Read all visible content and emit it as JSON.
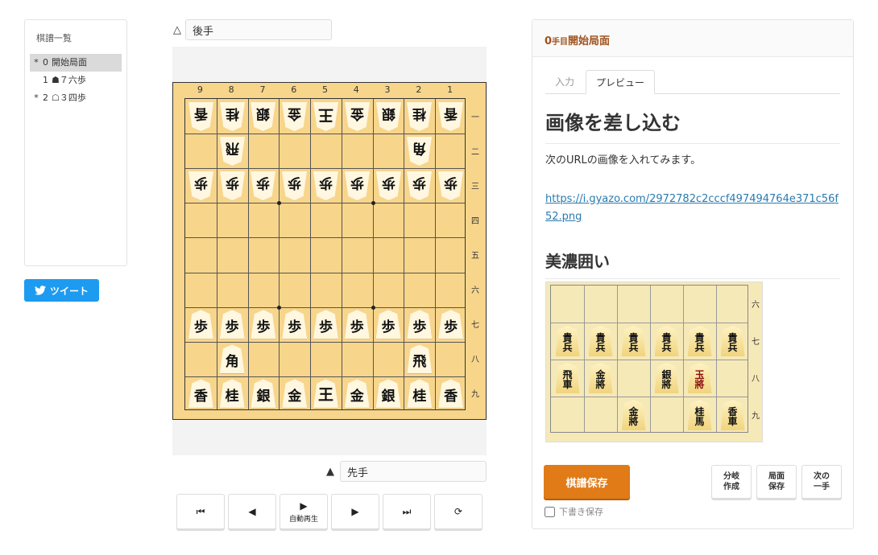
{
  "kifu_panel": {
    "title": "棋譜一覧",
    "moves": [
      {
        "mark": "*",
        "num": "0",
        "text": "開始局面",
        "selected": true
      },
      {
        "mark": "",
        "num": "1",
        "text": "☗７六歩",
        "selected": false
      },
      {
        "mark": "*",
        "num": "2",
        "text": "☖３四歩",
        "selected": false
      }
    ]
  },
  "tweet": {
    "label": "ツイート",
    "icon": "twitter-bird-icon"
  },
  "players": {
    "gote_mark": "△",
    "gote_name": "後手",
    "sente_mark": "▲",
    "sente_name": "先手"
  },
  "board": {
    "files": [
      "9",
      "8",
      "7",
      "6",
      "5",
      "4",
      "3",
      "2",
      "1"
    ],
    "ranks": [
      "一",
      "二",
      "三",
      "四",
      "五",
      "六",
      "七",
      "八",
      "九"
    ],
    "pieces": [
      {
        "f": 9,
        "r": 1,
        "p": "香",
        "side": "gote"
      },
      {
        "f": 8,
        "r": 1,
        "p": "桂",
        "side": "gote"
      },
      {
        "f": 7,
        "r": 1,
        "p": "銀",
        "side": "gote"
      },
      {
        "f": 6,
        "r": 1,
        "p": "金",
        "side": "gote"
      },
      {
        "f": 5,
        "r": 1,
        "p": "王",
        "side": "gote"
      },
      {
        "f": 4,
        "r": 1,
        "p": "金",
        "side": "gote"
      },
      {
        "f": 3,
        "r": 1,
        "p": "銀",
        "side": "gote"
      },
      {
        "f": 2,
        "r": 1,
        "p": "桂",
        "side": "gote"
      },
      {
        "f": 1,
        "r": 1,
        "p": "香",
        "side": "gote"
      },
      {
        "f": 8,
        "r": 2,
        "p": "飛",
        "side": "gote"
      },
      {
        "f": 2,
        "r": 2,
        "p": "角",
        "side": "gote"
      },
      {
        "f": 9,
        "r": 3,
        "p": "歩",
        "side": "gote"
      },
      {
        "f": 8,
        "r": 3,
        "p": "歩",
        "side": "gote"
      },
      {
        "f": 7,
        "r": 3,
        "p": "歩",
        "side": "gote"
      },
      {
        "f": 6,
        "r": 3,
        "p": "歩",
        "side": "gote"
      },
      {
        "f": 5,
        "r": 3,
        "p": "歩",
        "side": "gote"
      },
      {
        "f": 4,
        "r": 3,
        "p": "歩",
        "side": "gote"
      },
      {
        "f": 3,
        "r": 3,
        "p": "歩",
        "side": "gote"
      },
      {
        "f": 2,
        "r": 3,
        "p": "歩",
        "side": "gote"
      },
      {
        "f": 1,
        "r": 3,
        "p": "歩",
        "side": "gote"
      },
      {
        "f": 9,
        "r": 7,
        "p": "歩",
        "side": "sente"
      },
      {
        "f": 8,
        "r": 7,
        "p": "歩",
        "side": "sente"
      },
      {
        "f": 7,
        "r": 7,
        "p": "歩",
        "side": "sente"
      },
      {
        "f": 6,
        "r": 7,
        "p": "歩",
        "side": "sente"
      },
      {
        "f": 5,
        "r": 7,
        "p": "歩",
        "side": "sente"
      },
      {
        "f": 4,
        "r": 7,
        "p": "歩",
        "side": "sente"
      },
      {
        "f": 3,
        "r": 7,
        "p": "歩",
        "side": "sente"
      },
      {
        "f": 2,
        "r": 7,
        "p": "歩",
        "side": "sente"
      },
      {
        "f": 1,
        "r": 7,
        "p": "歩",
        "side": "sente"
      },
      {
        "f": 8,
        "r": 8,
        "p": "角",
        "side": "sente"
      },
      {
        "f": 2,
        "r": 8,
        "p": "飛",
        "side": "sente"
      },
      {
        "f": 9,
        "r": 9,
        "p": "香",
        "side": "sente"
      },
      {
        "f": 8,
        "r": 9,
        "p": "桂",
        "side": "sente"
      },
      {
        "f": 7,
        "r": 9,
        "p": "銀",
        "side": "sente"
      },
      {
        "f": 6,
        "r": 9,
        "p": "金",
        "side": "sente"
      },
      {
        "f": 5,
        "r": 9,
        "p": "王",
        "side": "sente"
      },
      {
        "f": 4,
        "r": 9,
        "p": "金",
        "side": "sente"
      },
      {
        "f": 3,
        "r": 9,
        "p": "銀",
        "side": "sente"
      },
      {
        "f": 2,
        "r": 9,
        "p": "桂",
        "side": "sente"
      },
      {
        "f": 1,
        "r": 9,
        "p": "香",
        "side": "sente"
      }
    ]
  },
  "controls": [
    {
      "name": "first-move-button",
      "icon": "⏮",
      "label": ""
    },
    {
      "name": "prev-move-button",
      "icon": "◀",
      "label": ""
    },
    {
      "name": "autoplay-button",
      "icon": "▶",
      "label": "自動再生"
    },
    {
      "name": "next-move-button",
      "icon": "▶",
      "label": ""
    },
    {
      "name": "last-move-button",
      "icon": "⏭",
      "label": ""
    },
    {
      "name": "flip-board-button",
      "icon": "⟳",
      "label": ""
    }
  ],
  "right_panel": {
    "title_num": "0",
    "title_unit": "手目",
    "title_text": "開始局面",
    "tabs": [
      {
        "label": "入力",
        "active": false
      },
      {
        "label": "プレビュー",
        "active": true
      }
    ],
    "h1": "画像を差し込む",
    "paragraph": "次のURLの画像を入れてみます。",
    "link": "https://i.gyazo.com/2972782c2cccf497494764e371c56f52.png",
    "h2": "美濃囲い",
    "embed": {
      "ranks": [
        "六",
        "七",
        "八",
        "九"
      ],
      "pieces": [
        {
          "c": 0,
          "r": 1,
          "t": [
            "貴",
            "兵"
          ],
          "red": false
        },
        {
          "c": 1,
          "r": 1,
          "t": [
            "貴",
            "兵"
          ],
          "red": false
        },
        {
          "c": 2,
          "r": 1,
          "t": [
            "貴",
            "兵"
          ],
          "red": false
        },
        {
          "c": 3,
          "r": 1,
          "t": [
            "貴",
            "兵"
          ],
          "red": false
        },
        {
          "c": 4,
          "r": 1,
          "t": [
            "貴",
            "兵"
          ],
          "red": false
        },
        {
          "c": 5,
          "r": 1,
          "t": [
            "貴",
            "兵"
          ],
          "red": false
        },
        {
          "c": 0,
          "r": 2,
          "t": [
            "飛",
            "車"
          ],
          "red": false
        },
        {
          "c": 1,
          "r": 2,
          "t": [
            "金",
            "將"
          ],
          "red": false
        },
        {
          "c": 3,
          "r": 2,
          "t": [
            "銀",
            "將"
          ],
          "red": false
        },
        {
          "c": 4,
          "r": 2,
          "t": [
            "玉",
            "將"
          ],
          "red": true
        },
        {
          "c": 2,
          "r": 3,
          "t": [
            "金",
            "將"
          ],
          "red": false
        },
        {
          "c": 4,
          "r": 3,
          "t": [
            "桂",
            "馬"
          ],
          "red": false
        },
        {
          "c": 5,
          "r": 3,
          "t": [
            "香",
            "車"
          ],
          "red": false
        }
      ]
    },
    "save_label": "棋譜保存",
    "buttons": [
      {
        "name": "branch-create-button",
        "label": "分岐\n作成"
      },
      {
        "name": "position-save-button",
        "label": "局面\n保存"
      },
      {
        "name": "next-move-small-button",
        "label": "次の\n一手"
      }
    ],
    "draft_label": "下書き保存",
    "draft_checked": false
  },
  "colors": {
    "accent": "#e07b18",
    "board": "#f7d58b",
    "link": "#2a7ab0",
    "tweet": "#1d9bf0",
    "title": "#a0521d"
  }
}
